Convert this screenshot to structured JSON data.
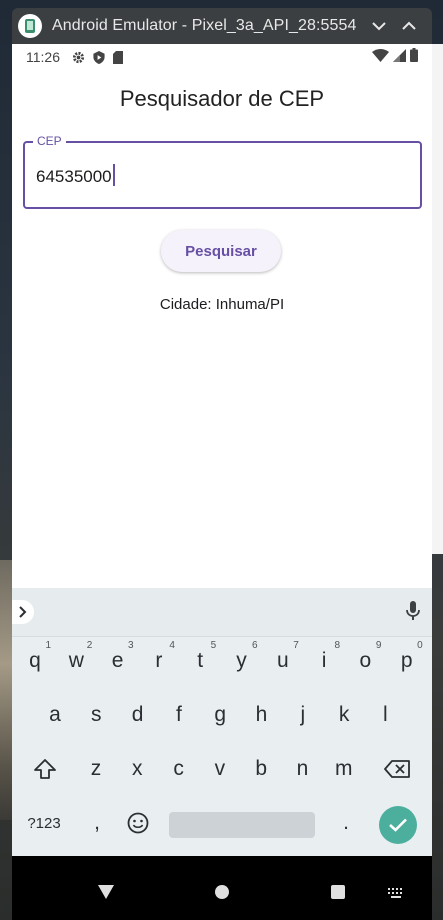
{
  "window": {
    "title": "Android Emulator - Pixel_3a_API_28:5554"
  },
  "statusbar": {
    "time": "11:26"
  },
  "app": {
    "title": "Pesquisador de CEP",
    "cep_field": {
      "label": "CEP",
      "value": "64535000"
    },
    "search_button": "Pesquisar",
    "result": "Cidade: Inhuma/PI"
  },
  "keyboard": {
    "row1": [
      {
        "k": "q",
        "n": "1"
      },
      {
        "k": "w",
        "n": "2"
      },
      {
        "k": "e",
        "n": "3"
      },
      {
        "k": "r",
        "n": "4"
      },
      {
        "k": "t",
        "n": "5"
      },
      {
        "k": "y",
        "n": "6"
      },
      {
        "k": "u",
        "n": "7"
      },
      {
        "k": "i",
        "n": "8"
      },
      {
        "k": "o",
        "n": "9"
      },
      {
        "k": "p",
        "n": "0"
      }
    ],
    "row2": [
      "a",
      "s",
      "d",
      "f",
      "g",
      "h",
      "j",
      "k",
      "l"
    ],
    "row3": [
      "z",
      "x",
      "c",
      "v",
      "b",
      "n",
      "m"
    ],
    "symbols_key": "?123",
    "comma": ",",
    "period": "."
  }
}
